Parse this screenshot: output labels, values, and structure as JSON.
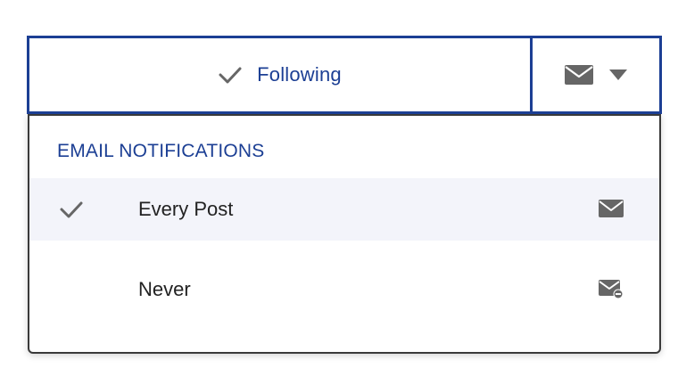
{
  "follow_button": {
    "label": "Following",
    "check_icon": "checkmark-icon"
  },
  "notification_toggle": {
    "icon": "envelope-icon",
    "caret_icon": "caret-down-icon"
  },
  "dropdown": {
    "header": "EMAIL NOTIFICATIONS",
    "items": [
      {
        "label": "Every Post",
        "selected": true,
        "icon": "envelope-icon"
      },
      {
        "label": "Never",
        "selected": false,
        "icon": "envelope-off-icon"
      }
    ]
  },
  "colors": {
    "accent": "#1c3f94",
    "selected_row_bg": "#f3f4fa",
    "icon_gray": "#666666"
  }
}
